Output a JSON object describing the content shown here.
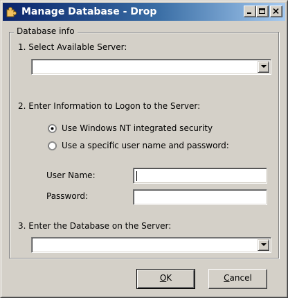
{
  "window": {
    "title": "Manage Database - Drop",
    "controls": {
      "minimize": "minimize",
      "maximize": "maximize",
      "close": "close"
    }
  },
  "group": {
    "legend": "Database info"
  },
  "server": {
    "label": "1. Select Available Server:",
    "value": ""
  },
  "logon": {
    "label": "2. Enter Information to Logon to the Server:",
    "options": [
      {
        "label": "Use Windows NT integrated security",
        "checked": true
      },
      {
        "label": "Use a specific user name and password:",
        "checked": false
      }
    ],
    "username_label": "User Name:",
    "username_value": "",
    "password_label": "Password:",
    "password_value": ""
  },
  "database": {
    "label": "3. Enter the Database on the Server:",
    "value": ""
  },
  "buttons": {
    "ok_accel": "O",
    "ok_rest": "K",
    "cancel_accel": "C",
    "cancel_rest": "ancel"
  },
  "colors": {
    "face": "#d4d0c8",
    "title_start": "#0a246a",
    "title_end": "#a6caf0",
    "title_text": "#ffffff"
  }
}
